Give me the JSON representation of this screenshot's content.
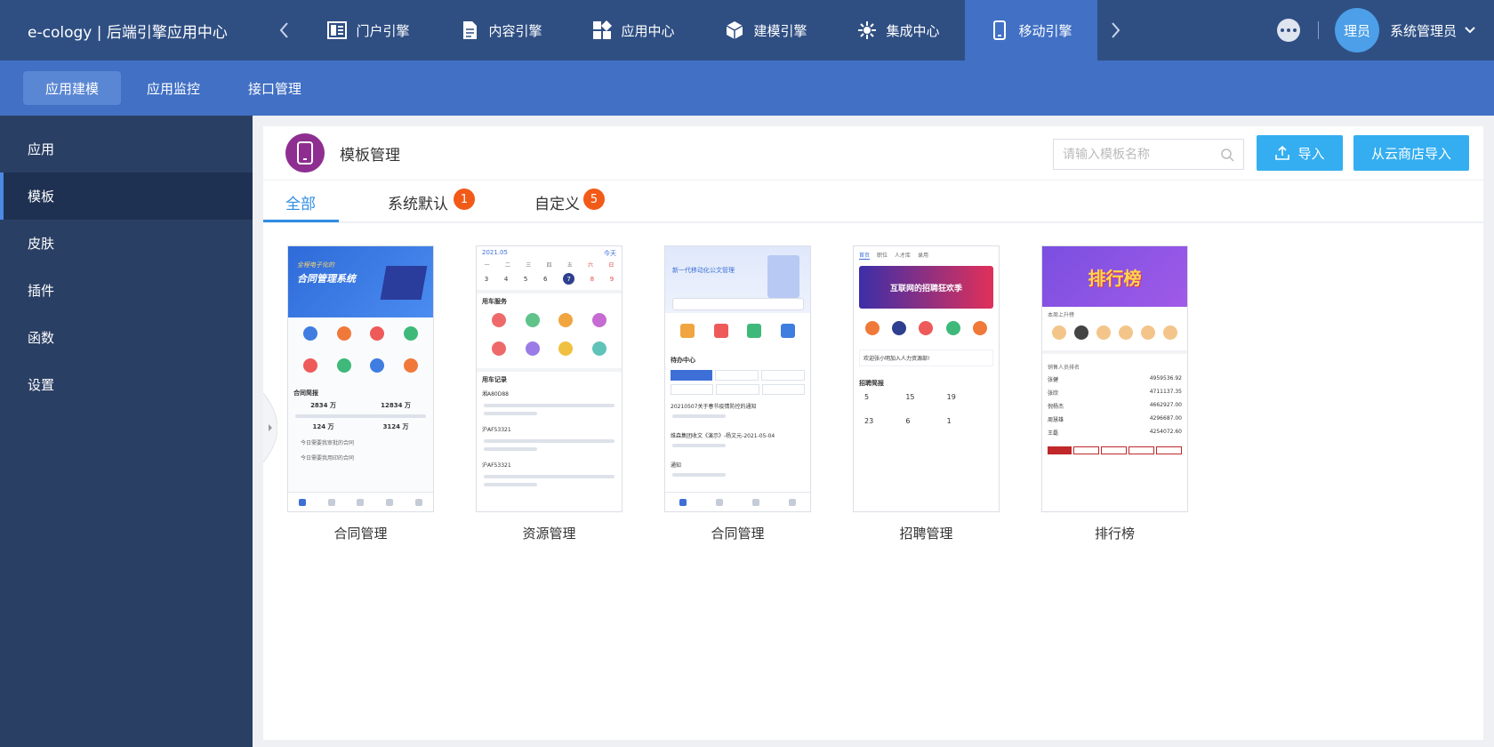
{
  "brand": "e-cology | 后端引擎应用中心",
  "nav": {
    "items": [
      {
        "label": "门户引擎",
        "icon": "portal-icon"
      },
      {
        "label": "内容引擎",
        "icon": "document-icon"
      },
      {
        "label": "应用中心",
        "icon": "apps-icon"
      },
      {
        "label": "建模引擎",
        "icon": "cube-icon"
      },
      {
        "label": "集成中心",
        "icon": "integration-icon"
      },
      {
        "label": "移动引擎",
        "icon": "mobile-icon",
        "active": true
      }
    ]
  },
  "user": {
    "avatar_text": "理员",
    "name": "系统管理员"
  },
  "subnav": {
    "tabs": [
      "应用建模",
      "应用监控",
      "接口管理"
    ]
  },
  "sidebar": {
    "items": [
      "应用",
      "模板",
      "皮肤",
      "插件",
      "函数",
      "设置"
    ]
  },
  "panel": {
    "title": "模板管理",
    "search_placeholder": "请输入模板名称",
    "import_label": "导入",
    "cloud_import_label": "从云商店导入"
  },
  "tabs": [
    {
      "label": "全部"
    },
    {
      "label": "系统默认",
      "badge": "1"
    },
    {
      "label": "自定义",
      "badge": "5"
    }
  ],
  "templates": [
    {
      "name": "合同管理",
      "banner_sub": "全程电子化的",
      "banner_title": "合同管理系统",
      "section": "合同简报",
      "stats": [
        "2834 万",
        "12834 万",
        "124 万",
        "3124 万"
      ],
      "items": [
        "今日需要我审批的合同",
        "今日需要我用印的合同"
      ]
    },
    {
      "name": "资源管理",
      "month": "2021.05",
      "today": "今天",
      "weekdays": [
        "一",
        "二",
        "三",
        "四",
        "五",
        "六",
        "日"
      ],
      "days": [
        "3",
        "4",
        "5",
        "6",
        "7",
        "8",
        "9"
      ],
      "section1": "用车服务",
      "section2": "用车记录",
      "plates": [
        "湘A80D88",
        "沪AF53321",
        "沪AF53321"
      ]
    },
    {
      "name": "合同管理",
      "banner_title": "新一代移动化公文管理",
      "section": "待办中心",
      "items": [
        "20210507关于春节疫情防控的通知",
        "维森集团收文《演示》-杨文元-2021-05-04",
        "通知"
      ]
    },
    {
      "name": "招聘管理",
      "tabs": [
        "首页",
        "职位",
        "人才库",
        "录用"
      ],
      "banner_title": "互联网的招聘狂欢季",
      "welcome": "欢迎张小明加入人力资源部!",
      "section": "招聘简报",
      "nums": [
        "5",
        "15",
        "19",
        "23",
        "6",
        "1"
      ]
    },
    {
      "name": "排行榜",
      "banner_title": "排行榜",
      "section1": "本周上升榜",
      "section2": "销售人员排名",
      "people": [
        "张健",
        "张欣",
        "倪杨杰",
        "周慧雄",
        "王磊"
      ],
      "values": [
        "4959536.92",
        "4711137.35",
        "4662927.00",
        "4296687.00",
        "4254072.60"
      ]
    }
  ],
  "colors": {
    "topbar": "#2f4f83",
    "subbar": "#4170c4",
    "sidebar": "#2a3f64",
    "accent": "#2f8de4",
    "button": "#34aef0",
    "badge": "#f25a17",
    "panel_icon": "#8e2e90"
  }
}
